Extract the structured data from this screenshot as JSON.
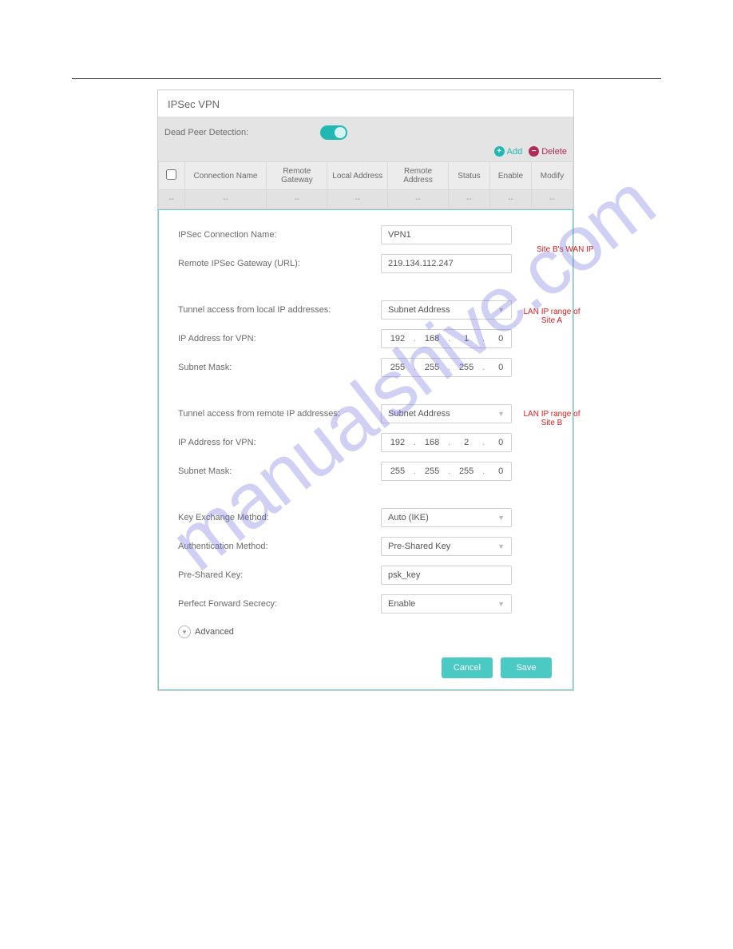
{
  "panel": {
    "title": "IPSec VPN",
    "dpd_label": "Dead Peer Detection:",
    "dpd_on": true,
    "add_label": "Add",
    "delete_label": "Delete"
  },
  "table": {
    "headers": {
      "name": "Connection Name",
      "remote_gw": "Remote Gateway",
      "local_addr": "Local Address",
      "remote_addr": "Remote Address",
      "status": "Status",
      "enable": "Enable",
      "modify": "Modify"
    },
    "empty_row": [
      "--",
      "--",
      "--",
      "--",
      "--",
      "--",
      "--",
      "--"
    ]
  },
  "form": {
    "conn_name_label": "IPSec Connection Name:",
    "conn_name_value": "VPN1",
    "remote_gw_label": "Remote IPSec Gateway (URL):",
    "remote_gw_value": "219.134.112.247",
    "tunnel_local_label": "Tunnel access from local IP addresses:",
    "tunnel_local_value": "Subnet Address",
    "ip_local_label": "IP Address for VPN:",
    "ip_local": [
      "192",
      "168",
      "1",
      "0"
    ],
    "mask_local_label": "Subnet Mask:",
    "mask_local": [
      "255",
      "255",
      "255",
      "0"
    ],
    "tunnel_remote_label": "Tunnel access from remote IP addresses:",
    "tunnel_remote_value": "Subnet Address",
    "ip_remote_label": "IP Address for VPN:",
    "ip_remote": [
      "192",
      "168",
      "2",
      "0"
    ],
    "mask_remote_label": "Subnet Mask:",
    "mask_remote": [
      "255",
      "255",
      "255",
      "0"
    ],
    "kex_label": "Key Exchange Method:",
    "kex_value": "Auto (IKE)",
    "auth_label": "Authentication Method:",
    "auth_value": "Pre-Shared Key",
    "psk_label": "Pre-Shared Key:",
    "psk_value": "psk_key",
    "pfs_label": "Perfect Forward Secrecy:",
    "pfs_value": "Enable",
    "advanced_label": "Advanced",
    "cancel_label": "Cancel",
    "save_label": "Save"
  },
  "annotations": {
    "siteb_wan": "Site B's WAN IP",
    "lan_a": "LAN IP range of Site A",
    "lan_b": "LAN IP range of Site B"
  },
  "watermark": "manualshive.com"
}
